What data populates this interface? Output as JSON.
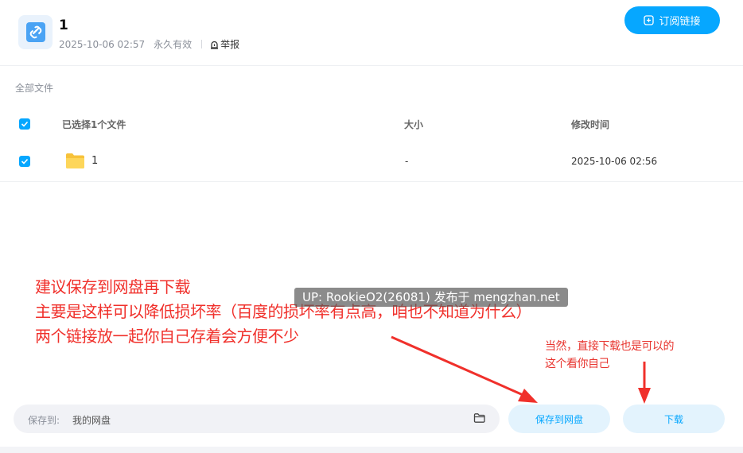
{
  "share": {
    "title": "1",
    "date": "2025-10-06 02:57",
    "validity": "永久有效",
    "report_label": "举报"
  },
  "subscribe_label": "订阅链接",
  "breadcrumb": "全部文件",
  "table": {
    "columns": [
      "已选择1个文件",
      "大小",
      "修改时间"
    ],
    "rows": [
      {
        "name": "1",
        "size": "-",
        "modified": "2025-10-06 02:56",
        "checked": true
      }
    ]
  },
  "annotations": {
    "main_lines": [
      "建议保存到网盘再下载",
      "主要是这样可以降低损坏率（百度的损坏率有点高，咱也不知道为什么）",
      "两个链接放一起你自己存着会方便不少"
    ],
    "side_lines": [
      "当然，直接下载也是可以的",
      "这个看你自己"
    ],
    "watermark": "UP: RookieO2(26081) 发布于 mengzhan.net"
  },
  "footer": {
    "save_to_label": "保存到:",
    "save_to_value": "我的网盘",
    "save_button": "保存到网盘",
    "download_button": "下载"
  },
  "colors": {
    "accent": "#06a7ff",
    "annotation": "#f0302b"
  }
}
